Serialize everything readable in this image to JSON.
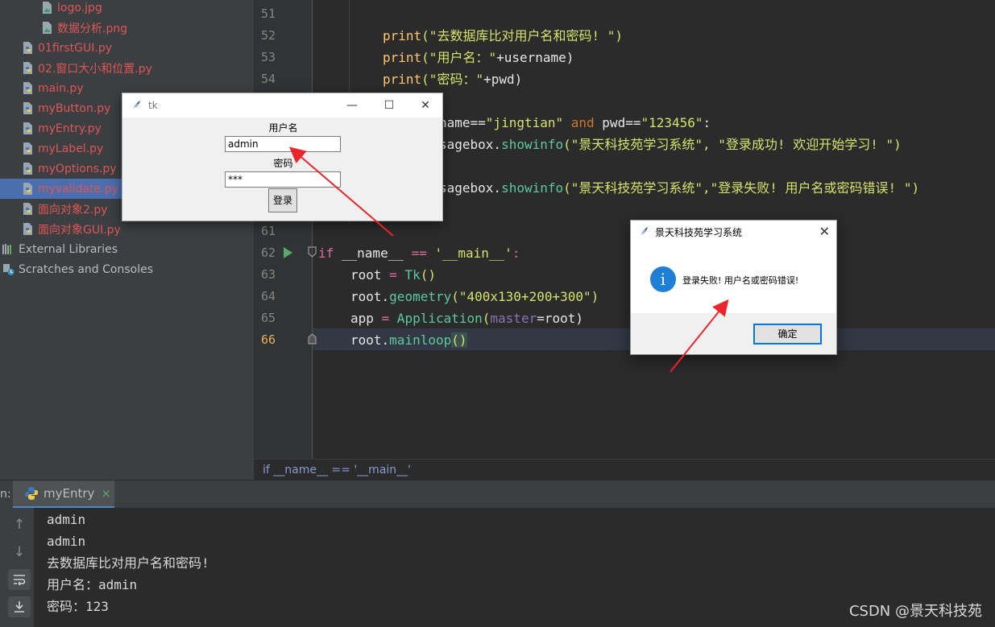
{
  "project_tree": {
    "items": [
      {
        "label": "logo.jpg",
        "icon": "image-file-icon",
        "indent": 2
      },
      {
        "label": "数据分析.png",
        "icon": "image-file-icon",
        "indent": 2
      },
      {
        "label": "01firstGUI.py",
        "icon": "python-file-icon",
        "indent": 1
      },
      {
        "label": "02.窗口大小和位置.py",
        "icon": "python-file-icon",
        "indent": 1
      },
      {
        "label": "main.py",
        "icon": "python-file-icon",
        "indent": 1
      },
      {
        "label": "myButton.py",
        "icon": "python-file-icon",
        "indent": 1
      },
      {
        "label": "myEntry.py",
        "icon": "python-file-icon",
        "indent": 1
      },
      {
        "label": "myLabel.py",
        "icon": "python-file-icon",
        "indent": 1
      },
      {
        "label": "myOptions.py",
        "icon": "python-file-icon",
        "indent": 1
      },
      {
        "label": "myvalidate.py",
        "icon": "python-file-icon",
        "indent": 1,
        "selected": true
      },
      {
        "label": "面向对象2.py",
        "icon": "python-file-icon",
        "indent": 1
      },
      {
        "label": "面向对象GUI.py",
        "icon": "python-file-icon",
        "indent": 1
      },
      {
        "label": "External Libraries",
        "icon": "library-icon",
        "indent": 0
      },
      {
        "label": "Scratches and Consoles",
        "icon": "scratches-icon",
        "indent": 0
      }
    ]
  },
  "editor": {
    "line_numbers": [
      "51",
      "52",
      "53",
      "54",
      "61",
      "62",
      "63",
      "64",
      "65",
      "66"
    ],
    "current_line": "66",
    "code": {
      "l52_fn": "print",
      "l52_str": "(\"去数据库比对用户名和密码! \")",
      "l53_fn": "print",
      "l53_a": "(\"用户名：\"",
      "l53_b": "+username)",
      "l54_fn": "print",
      "l54_a": "(\"密码：\"",
      "l54_b": "+pwd)",
      "l55_a": "name==",
      "l55_b": "\"jingtian\"",
      "l55_c": " and ",
      "l55_d": "pwd==",
      "l55_e": "\"123456\"",
      "l55_f": ":",
      "l56_a": "sagebox.",
      "l56_b": "showinfo",
      "l56_c": "(\"景天科技苑学习系统\", \"登录成功! 欢迎开始学习! \")",
      "l58_a": "sagebox.",
      "l58_b": "showinfo",
      "l58_c": "(\"景天科技苑学习系统\",\"登录失败! 用户名或密码错误! \")",
      "l62_kw": "if",
      "l62_name": " __name__ ",
      "l62_eq": "==",
      "l62_str": " '__main__'",
      "l62_colon": ":",
      "l63_a": "root ",
      "l63_eq": "=",
      "l63_b": " Tk",
      "l63_c": "()",
      "l64_a": "root.",
      "l64_b": "geometry",
      "l64_c": "(\"400x130+200+300\")",
      "l65_a": "app ",
      "l65_eq": "=",
      "l65_b": " Application",
      "l65_c": "(",
      "l65_d": "master",
      "l65_e": "=root)",
      "l66_a": "root.",
      "l66_b": "mainloop",
      "l66_c": "()"
    },
    "breadcrumb": "if __name__ == '__main__'"
  },
  "run_panel": {
    "label": "n:",
    "tab_label": "myEntry",
    "tab_close": "×",
    "console_lines": [
      "admin",
      "admin",
      "去数据库比对用户名和密码!",
      "用户名：admin",
      "密码：123"
    ],
    "watermark": "CSDN @景天科技苑"
  },
  "tk_window": {
    "title": "tk",
    "username_label": "用户名",
    "username_value": "admin",
    "password_label": "密码",
    "password_value": "***",
    "login_button": "登录"
  },
  "messagebox": {
    "title": "景天科技苑学习系统",
    "message": "登录失败! 用户名或密码错误!",
    "ok_button": "确定"
  },
  "colors": {
    "annotation_arrow": "#e8262b",
    "selection": "#4b6eaf"
  }
}
